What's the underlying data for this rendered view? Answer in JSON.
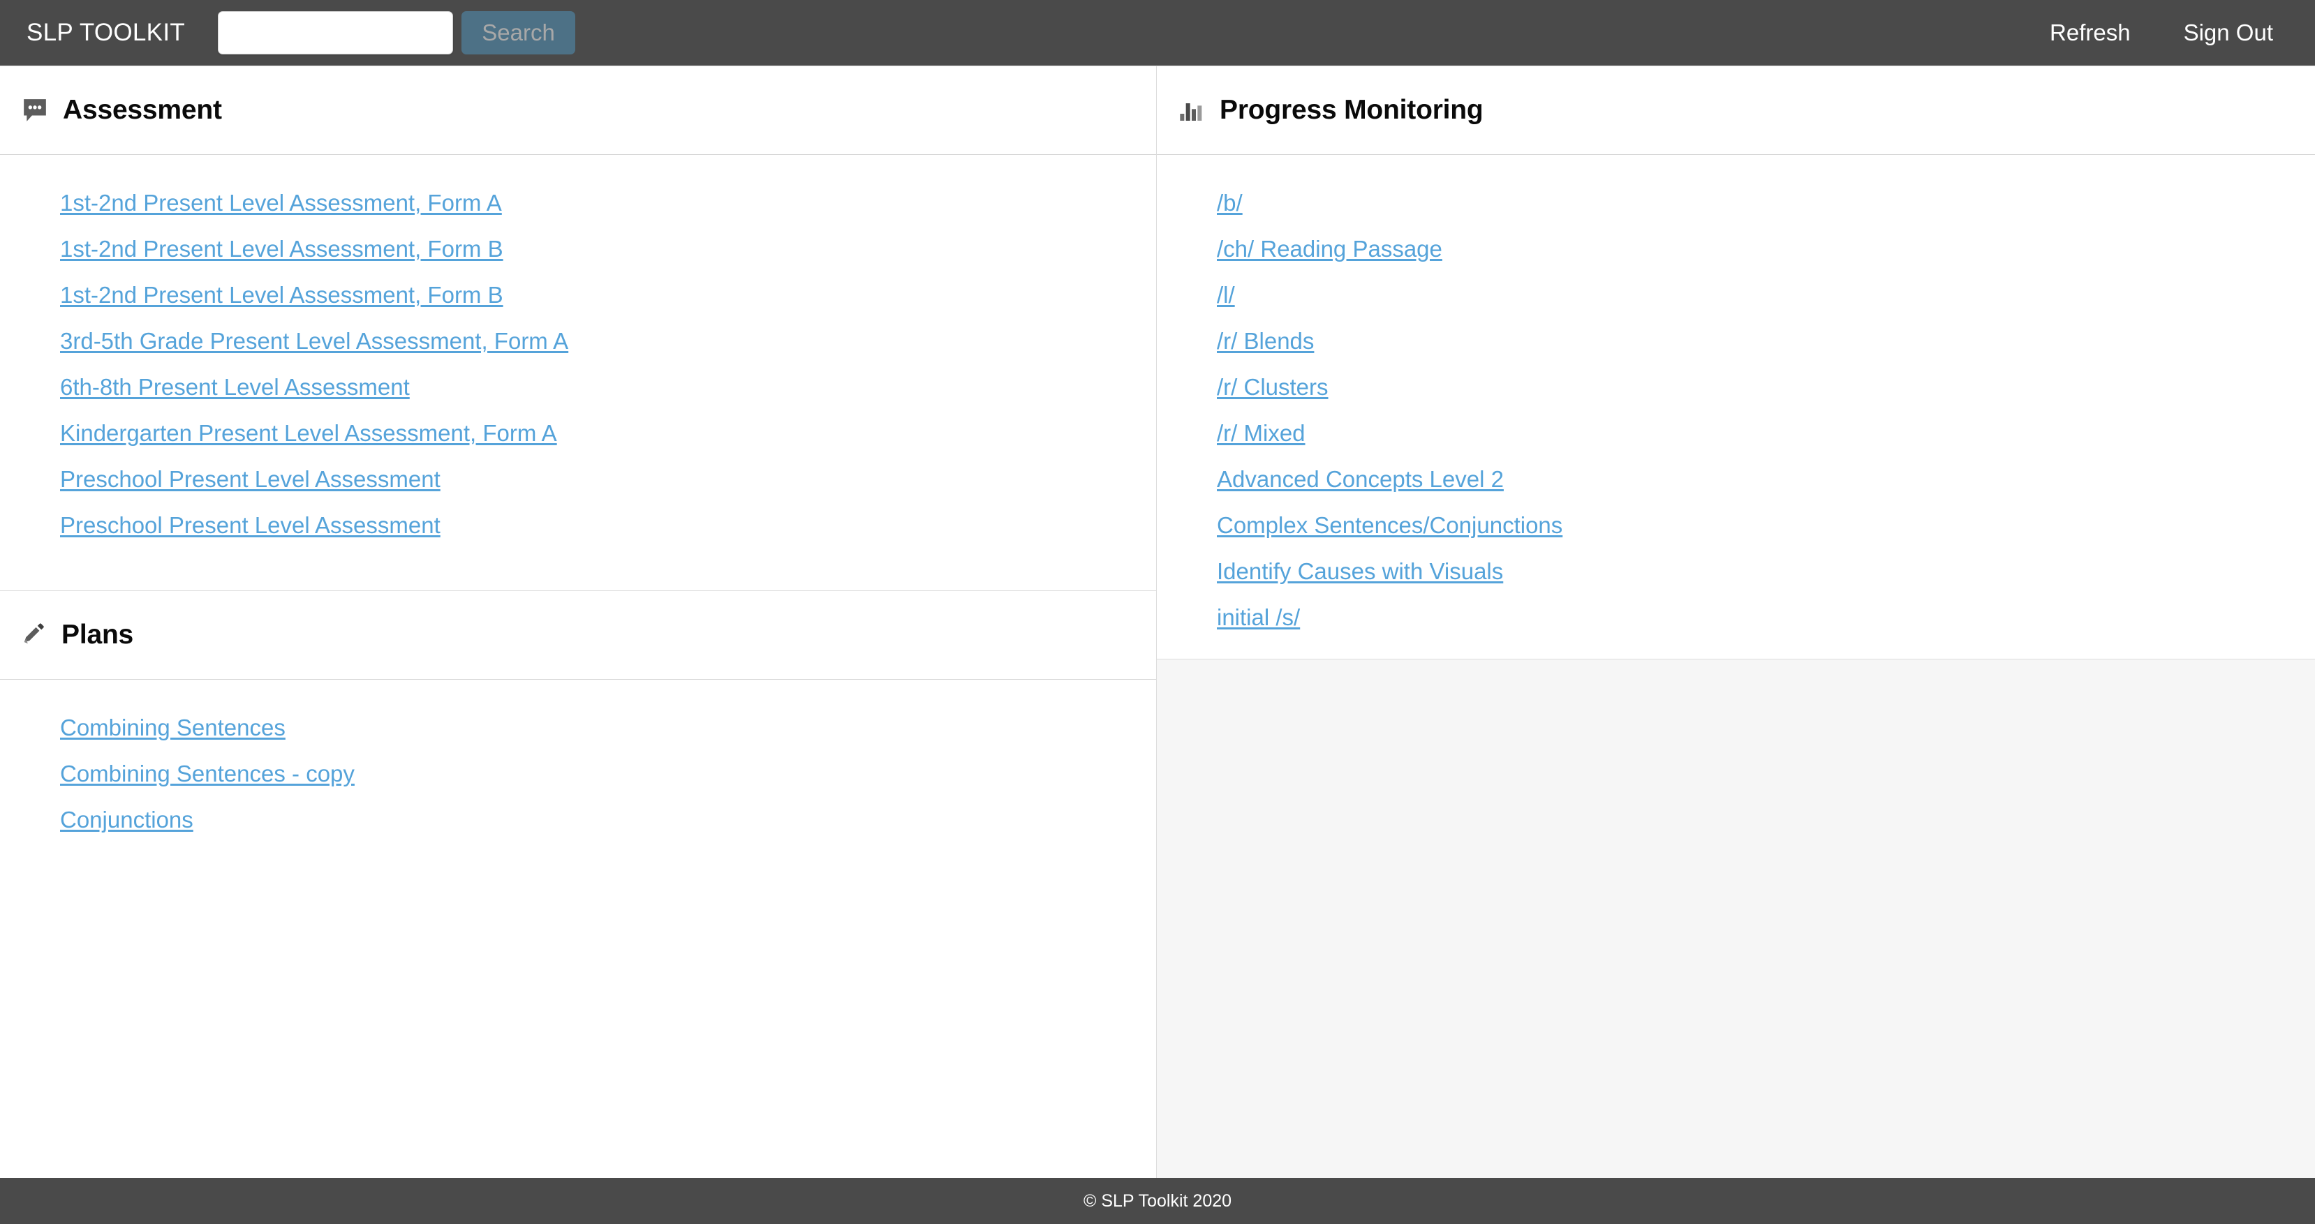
{
  "header": {
    "brand": "SLP TOOLKIT",
    "search": {
      "value": "",
      "placeholder": "",
      "button_label": "Search"
    },
    "nav": [
      {
        "label": "Refresh"
      },
      {
        "label": "Sign Out"
      }
    ]
  },
  "panels": {
    "assessment": {
      "title": "Assessment",
      "icon": "comment-dots-icon",
      "items": [
        {
          "label": "1st-2nd Present Level Assessment, Form A"
        },
        {
          "label": "1st-2nd Present Level Assessment, Form B"
        },
        {
          "label": "1st-2nd Present Level Assessment, Form B"
        },
        {
          "label": "3rd-5th Grade Present Level Assessment, Form A"
        },
        {
          "label": "6th-8th Present Level Assessment"
        },
        {
          "label": "Kindergarten Present Level Assessment, Form A"
        },
        {
          "label": "Preschool Present Level Assessment"
        },
        {
          "label": "Preschool Present Level Assessment"
        }
      ]
    },
    "plans": {
      "title": "Plans",
      "icon": "pencil-icon",
      "items": [
        {
          "label": "Combining Sentences"
        },
        {
          "label": "Combining Sentences - copy"
        },
        {
          "label": "Conjunctions"
        }
      ]
    },
    "progress_monitoring": {
      "title": "Progress Monitoring",
      "icon": "bar-chart-icon",
      "items": [
        {
          "label": "/b/"
        },
        {
          "label": "/ch/ Reading Passage"
        },
        {
          "label": "/l/"
        },
        {
          "label": "/r/ Blends"
        },
        {
          "label": "/r/ Clusters"
        },
        {
          "label": "/r/ Mixed"
        },
        {
          "label": "Advanced Concepts Level 2"
        },
        {
          "label": "Complex Sentences/Conjunctions"
        },
        {
          "label": "Identify Causes with Visuals"
        },
        {
          "label": "initial /s/"
        }
      ]
    }
  },
  "footer": {
    "copyright": "© SLP Toolkit 2020"
  },
  "colors": {
    "topbar": "#4a4a4a",
    "search_button": "#4d7186",
    "link": "#55a3da",
    "panel_divider": "#d4d4d4",
    "right_empty_bg": "#f6f6f6",
    "footer": "#4a4a4a"
  }
}
